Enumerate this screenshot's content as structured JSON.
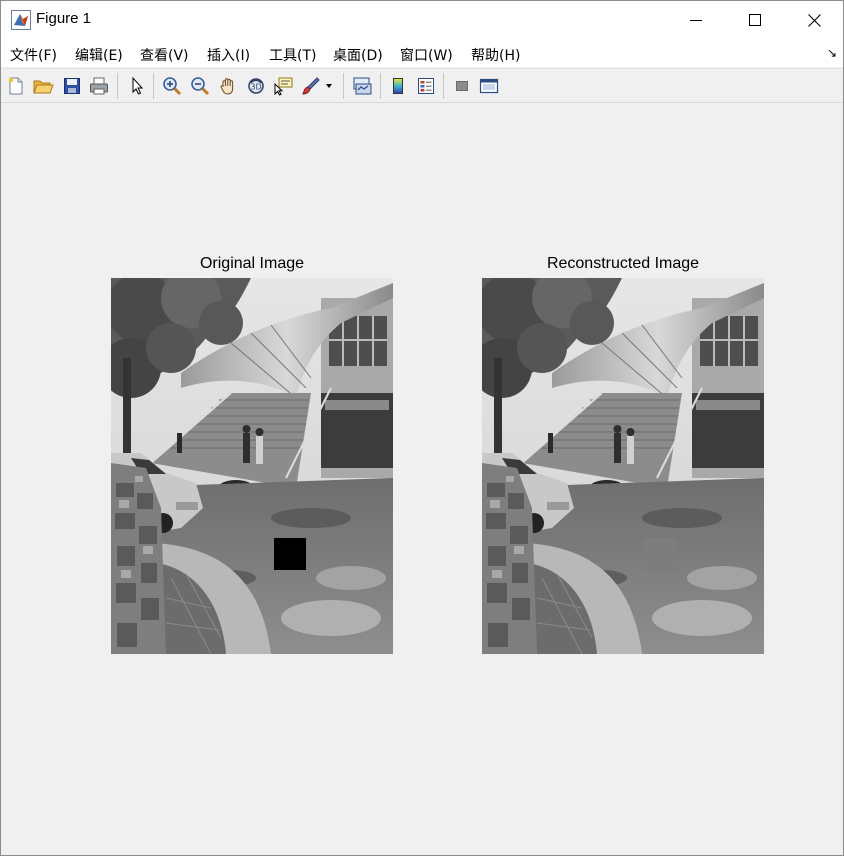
{
  "window": {
    "title": "Figure 1",
    "controls": [
      "minimize",
      "maximize",
      "close"
    ]
  },
  "menu": {
    "items": [
      {
        "label": "文件(F)"
      },
      {
        "label": "编辑(E)"
      },
      {
        "label": "查看(V)"
      },
      {
        "label": "插入(I)"
      },
      {
        "label": "工具(T)"
      },
      {
        "label": "桌面(D)"
      },
      {
        "label": "窗口(W)"
      },
      {
        "label": "帮助(H)"
      }
    ],
    "overflow_glyph": "↘"
  },
  "toolbar": {
    "buttons": [
      "new-figure-icon",
      "open-folder-icon",
      "save-icon",
      "print-icon",
      "select-pointer-icon",
      "zoom-in-icon",
      "zoom-out-icon",
      "pan-hand-icon",
      "rotate-3d-icon",
      "data-cursor-icon",
      "brush-icon",
      "brush-dropdown-icon",
      "link-plot-icon",
      "colorbar-icon",
      "legend-icon",
      "hide-plot-tools-icon",
      "show-plot-tools-icon"
    ]
  },
  "figure": {
    "left_title": "Original Image",
    "right_title": "Reconstructed Image"
  },
  "colors": {
    "titlebar_bg": "#ffffff",
    "figure_bg": "#f0f0f0",
    "occlusion_block": "#000000"
  }
}
